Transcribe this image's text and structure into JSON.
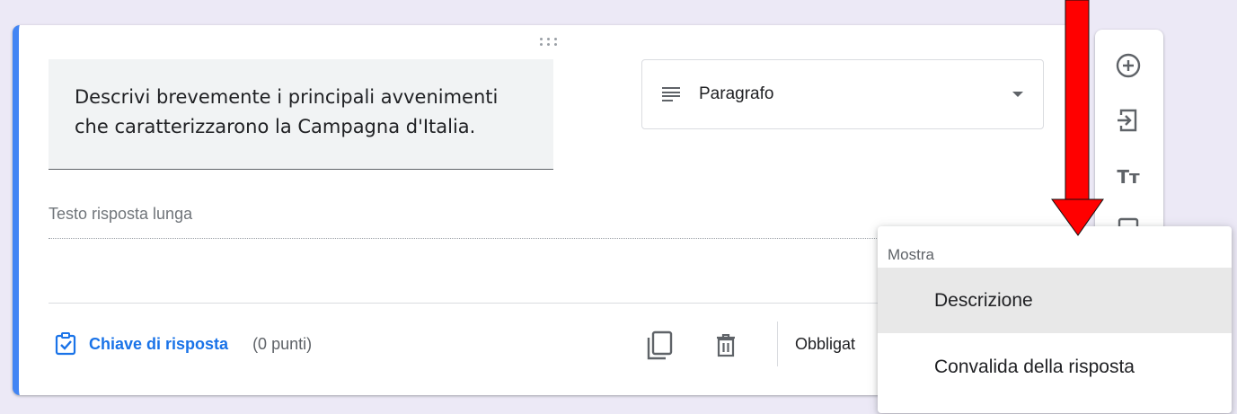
{
  "question": {
    "text_line1": "Descrivi brevemente i principali avvenimenti",
    "text_line2": "che caratterizzarono la Campagna d'Italia."
  },
  "type_select": {
    "selected": "Paragrafo",
    "icon": "paragraph-lines-icon"
  },
  "answer": {
    "placeholder": "Testo risposta lunga"
  },
  "footer": {
    "answer_key_label": "Chiave di risposta",
    "answer_key_icon": "checklist-clipboard-icon",
    "points": "(0 punti)",
    "required_label": "Obbligat"
  },
  "side_toolbar": {
    "items": [
      {
        "icon": "add-circle-icon"
      },
      {
        "icon": "import-question-icon"
      },
      {
        "icon": "add-title-icon",
        "label": "Tт"
      },
      {
        "icon": "add-image-icon"
      }
    ]
  },
  "menu": {
    "header": "Mostra",
    "items": [
      {
        "label": "Descrizione"
      },
      {
        "label": "Convalida della risposta"
      }
    ]
  },
  "colors": {
    "accent": "#4285f4",
    "link": "#1a73e8",
    "annotation_arrow": "#ff0000",
    "menu_hover": "#e8e8e8"
  }
}
